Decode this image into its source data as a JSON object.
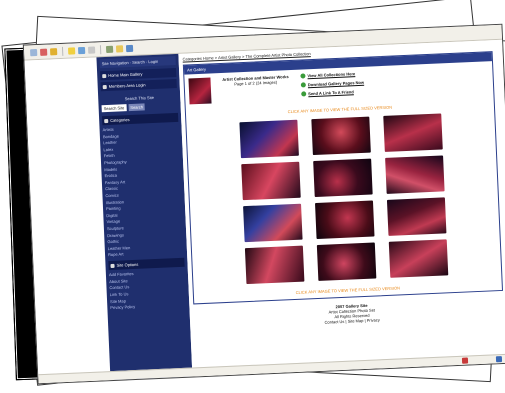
{
  "colors": {
    "sidebar": "#1f2f6e",
    "accent_orange": "#e8891a",
    "panel_border": "#2b3f8c"
  },
  "sidebar": {
    "top_label": "Site Navigation  ·  Search  ·  Login",
    "buttons": [
      "Home Main Gallery",
      "Members Area Login"
    ],
    "search_label": "Search This Site",
    "search_value": "Search Site",
    "search_go": "Search",
    "categories_title": "Categories",
    "categories": [
      "Artists",
      "Bondage",
      "Leather",
      "Latex",
      "Fetish",
      "Photography",
      "Models",
      "Erotica",
      "Fantasy Art",
      "Classic",
      "Comics",
      "Illustration",
      "Painting",
      "Digital",
      "Vintage",
      "Sculpture",
      "Drawings",
      "Gothic",
      "Leather Men",
      "Rope Art"
    ],
    "more_title": "Site Options",
    "more": [
      "Add Favorites",
      "About Site",
      "Contact Us",
      "Link To Us",
      "Site Map",
      "Privacy Policy"
    ]
  },
  "breadcrumb": "Categories Home > Artist Gallery > The Complete Artist Photo Collection",
  "panel": {
    "title": "Art Gallery",
    "title_block": [
      "Artist Collection and Master Works",
      "Page 1 of 2  (24 Images)"
    ],
    "links": [
      "View All Collections Here",
      "Download Gallery Pages Now",
      "Send A Link To A Friend"
    ],
    "notice_top": "CLICK ANY IMAGE TO VIEW THE FULL SIZED VERSION",
    "notice_bottom": "CLICK ANY IMAGE TO VIEW THE FULL SIZED VERSION"
  },
  "photos": [
    {
      "name": "photo-1",
      "fill": "linear-gradient(135deg,#08102e,#3a2a8a 40%,#c23650 75%,#1a0a20)"
    },
    {
      "name": "photo-2",
      "fill": "radial-gradient(circle at 50% 40%,#d24a5a,#5a0e1c 55%,#120610)"
    },
    {
      "name": "photo-3",
      "fill": "linear-gradient(160deg,#200713,#b8304a 50%,#3a0a1d)"
    },
    {
      "name": "photo-4",
      "fill": "linear-gradient(120deg,#5a0e1c,#d84660 50%,#21091a)"
    },
    {
      "name": "photo-5",
      "fill": "radial-gradient(circle at 40% 60%,#b8304a,#3a0a1d 50%,#0e0410)"
    },
    {
      "name": "photo-6",
      "fill": "linear-gradient(200deg,#14051a,#9a2440 45%,#d15068 65%,#1f0818)"
    },
    {
      "name": "photo-7",
      "fill": "linear-gradient(135deg,#0c1438,#3440a0 35%,#d24a5a 70%,#20091a)"
    },
    {
      "name": "photo-8",
      "fill": "radial-gradient(circle at 55% 45%,#c23650,#4a0c18 55%,#0a040c)"
    },
    {
      "name": "photo-9",
      "fill": "linear-gradient(160deg,#18071a,#5a1226 40%,#c03a52 70%,#2a0a1a)"
    },
    {
      "name": "photo-10",
      "fill": "linear-gradient(110deg,#200813,#d34860 45%,#36091a)"
    },
    {
      "name": "photo-11",
      "fill": "radial-gradient(circle at 45% 55%,#cf4560,#3e0b1a 55%,#0b040c)"
    },
    {
      "name": "photo-12",
      "fill": "linear-gradient(150deg,#2a0a18,#c8405a 50%,#1a0612)"
    }
  ],
  "footer": [
    "2007 Gallery Site",
    "Artist Collection Photo Set",
    "All Rights Reserved",
    "Contact Us | Site Map | Privacy"
  ]
}
